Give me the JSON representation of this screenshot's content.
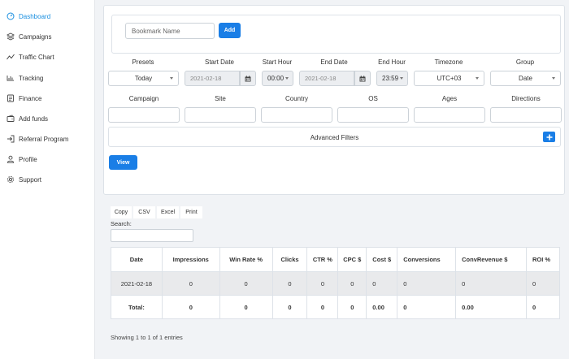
{
  "sidebar": {
    "items": [
      {
        "label": "Dashboard",
        "icon": "dashboard-icon",
        "active": true
      },
      {
        "label": "Campaigns",
        "icon": "layers-icon"
      },
      {
        "label": "Traffic Chart",
        "icon": "line-chart-icon"
      },
      {
        "label": "Tracking",
        "icon": "tracking-icon"
      },
      {
        "label": "Finance",
        "icon": "finance-icon"
      },
      {
        "label": "Add funds",
        "icon": "wallet-icon"
      },
      {
        "label": "Referral Program",
        "icon": "login-icon"
      },
      {
        "label": "Profile",
        "icon": "user-icon"
      },
      {
        "label": "Support",
        "icon": "gear-icon"
      }
    ],
    "accent": "#1a8fe0"
  },
  "bookmark": {
    "placeholder": "Bookmark Name",
    "add_label": "Add"
  },
  "filters": {
    "presets": {
      "label": "Presets",
      "value": "Today"
    },
    "start_date": {
      "label": "Start Date",
      "value": "2021-02-18"
    },
    "start_hour": {
      "label": "Start Hour",
      "value": "00:00"
    },
    "end_date": {
      "label": "End Date",
      "value": "2021-02-18"
    },
    "end_hour": {
      "label": "End Hour",
      "value": "23:59"
    },
    "timezone": {
      "label": "Timezone",
      "value": "UTC+03"
    },
    "group": {
      "label": "Group",
      "value": "Date"
    },
    "campaign": {
      "label": "Campaign"
    },
    "site": {
      "label": "Site"
    },
    "country": {
      "label": "Country"
    },
    "os": {
      "label": "OS"
    },
    "ages": {
      "label": "Ages"
    },
    "directions": {
      "label": "Directions"
    },
    "advanced": "Advanced Filters",
    "view_label": "View"
  },
  "export": {
    "copy": "Copy",
    "csv": "CSV",
    "excel": "Excel",
    "print": "Print"
  },
  "search_label": "Search:",
  "table": {
    "headers": [
      "Date",
      "Impressions",
      "Win Rate %",
      "Clicks",
      "CTR %",
      "CPC $",
      "Cost $",
      "Conversions",
      "ConvRevenue $",
      "ROI %"
    ],
    "rows": [
      [
        "2021-02-18",
        "0",
        "0",
        "0",
        "0",
        "0",
        "0",
        "0",
        "0",
        "0"
      ]
    ],
    "total": [
      "Total:",
      "0",
      "0",
      "0",
      "0",
      "0",
      "0.00",
      "0",
      "0.00",
      "0"
    ]
  },
  "entries_info": "Showing 1 to 1 of 1 entries",
  "colors": {
    "primary": "#1a7ee6",
    "background": "#f1f3f6"
  }
}
